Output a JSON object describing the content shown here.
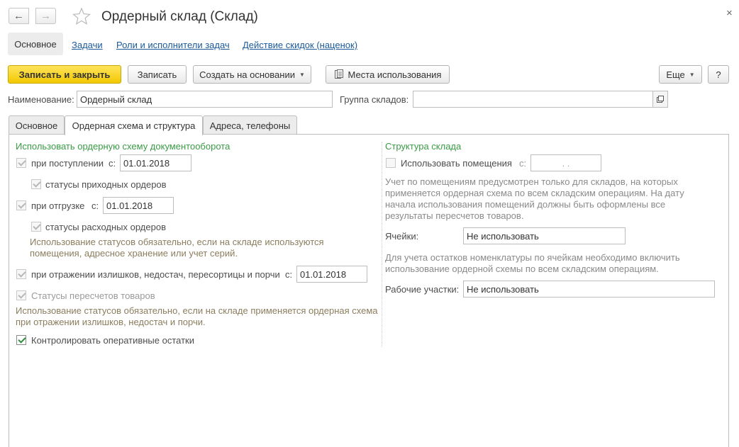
{
  "window": {
    "title": "Ордерный склад (Склад)",
    "back_icon": "arrow-left-icon",
    "forward_icon": "arrow-right-icon",
    "favorite_icon": "star-icon",
    "close_glyph": "×"
  },
  "sections": {
    "active": "Основное",
    "links": [
      "Задачи",
      "Роли и исполнители задач",
      "Действие скидок (наценок)"
    ]
  },
  "toolbar": {
    "save_close": "Записать и закрыть",
    "save": "Записать",
    "create_based": "Создать на основании",
    "usage_places": "Места использования",
    "more": "Еще",
    "help": "?"
  },
  "header_fields": {
    "name_label": "Наименование:",
    "name_value": "Ордерный склад",
    "group_label": "Группа складов:",
    "group_value": ""
  },
  "tabs": [
    "Основное",
    "Ордерная схема и структура",
    "Адреса, телефоны"
  ],
  "left": {
    "group_title": "Использовать ордерную схему документооборота",
    "receipt": {
      "label": "при поступлении",
      "from": "с:",
      "date": "01.01.2018"
    },
    "receipt_statuses": "статусы приходных ордеров",
    "shipment": {
      "label": "при отгрузке",
      "from": "с:",
      "date": "01.01.2018"
    },
    "shipment_statuses": "статусы расходных ордеров",
    "statuses_note": "Использование статусов обязательно, если на складе используются помещения, адресное хранение или учет серий.",
    "surplus": {
      "label": "при отражении излишков, недостач, пересортицы и порчи",
      "from": "с:",
      "date": "01.01.2018"
    },
    "recount_statuses": "Статусы пересчетов товаров",
    "recount_note": "Использование статусов обязательно, если на складе применяется ордерная схема при отражении излишков, недостач и порчи.",
    "control_balances": "Контролировать оперативные остатки"
  },
  "right": {
    "group_title": "Структура склада",
    "use_rooms": {
      "label": "Использовать помещения",
      "from": "с:",
      "date": " .  . "
    },
    "rooms_note": "Учет по помещениям предусмотрен только для складов, на которых применяется ордерная схема по всем складским операциям. На дату начала использования помещений должны быть оформлены все результаты пересчетов товаров.",
    "cells_label": "Ячейки:",
    "cells_value": "Не использовать",
    "cells_note": "Для учета остатков номенклатуры по ячейкам необходимо включить использование ордерной схемы по всем складским операциям.",
    "work_areas_label": "Рабочие участки:",
    "work_areas_value": "Не использовать"
  }
}
